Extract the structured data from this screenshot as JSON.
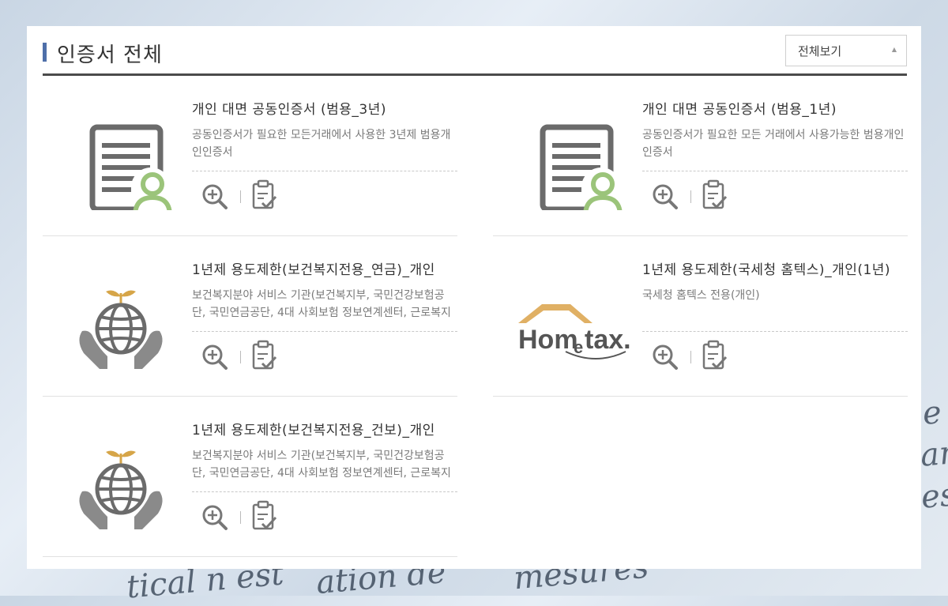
{
  "background": {
    "text_lines": [
      "e",
      "ar",
      "es",
      "tical n est",
      "ation de",
      "mesures"
    ]
  },
  "header": {
    "title": "인증서 전체",
    "filter_select": {
      "value": "전체보기",
      "arrow": "▲"
    }
  },
  "certificates": [
    {
      "title": "개인 대면 공동인증서 (범용_3년)",
      "description": "공동인증서가 필요한 모든거래에서 사용한 3년제 범용개인인증서",
      "icon": "certificate-person-icon"
    },
    {
      "title": "개인 대면 공동인증서 (범용_1년)",
      "description": "공동인증서가 필요한 모든 거래에서 사용가능한 범용개인 인증서",
      "icon": "certificate-person-icon"
    },
    {
      "title": "1년제 용도제한(보건복지전용_연금)_개인",
      "description": "보건복지분야 서비스 기관(보건복지부, 국민건강보험공단, 국민연금공단, 4대 사회보험 정보연계센터, 근로복지공단)",
      "icon": "globe-hands-icon"
    },
    {
      "title": "1년제 용도제한(국세청 홈텍스)_개인(1년)",
      "description": "국세청 홈텍스 전용(개인)",
      "icon": "hometax-logo",
      "logo_text": {
        "h": "Hom",
        "e": "e",
        "tax": "tax."
      }
    },
    {
      "title": "1년제 용도제한(보건복지전용_건보)_개인",
      "description": "보건복지분야 서비스 기관(보건복지부, 국민건강보험공단, 국민연금공단, 4대 사회보험 정보연계센터, 근로복지공단)",
      "icon": "globe-hands-icon"
    }
  ],
  "colors": {
    "accent": "#4e6fa9",
    "icon_gray": "#6b6b6b",
    "icon_green": "#9bc47a",
    "sprout": "#d6a548",
    "hometax_roof": "#e0b064",
    "hometax_text": "#555555"
  }
}
